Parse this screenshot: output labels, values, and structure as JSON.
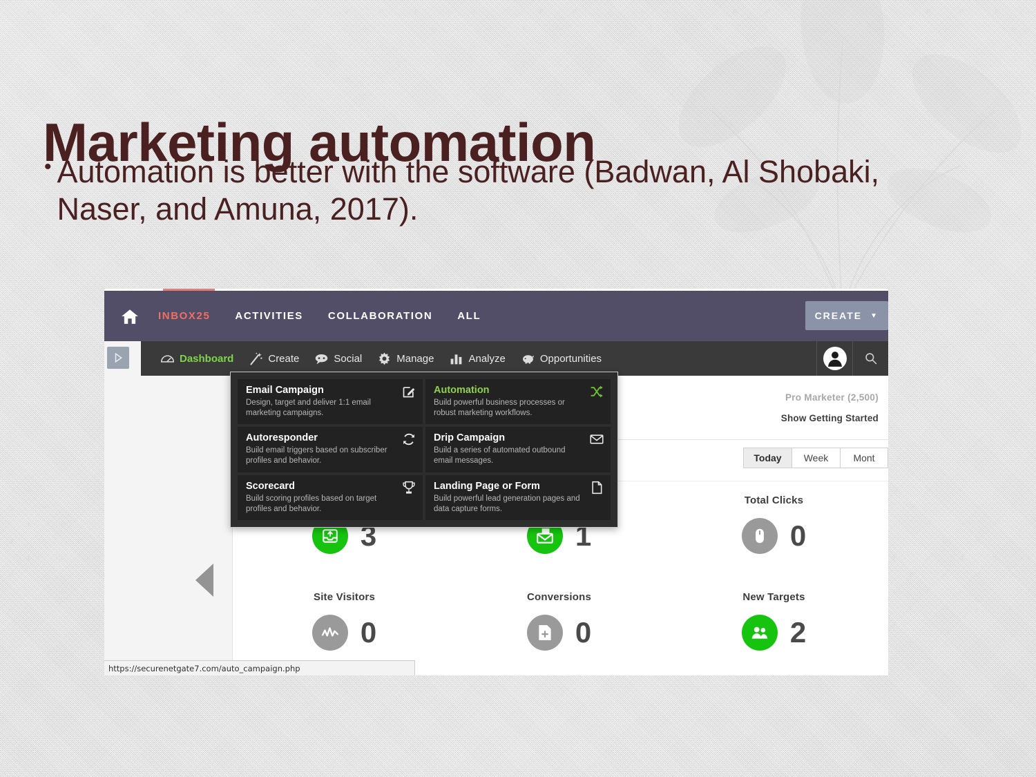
{
  "slide": {
    "title": "Marketing automation",
    "bullets": [
      "Automation is better with the software (Badwan, Al Shobaki, Naser, and Amuna, 2017)."
    ],
    "text_color": "#4a2020",
    "background_color": "#dcdcdc"
  },
  "app": {
    "top_nav": {
      "home_icon": "home-icon",
      "items": [
        {
          "label": "INBOX25",
          "accent": true
        },
        {
          "label": "ACTIVITIES",
          "accent": false
        },
        {
          "label": "COLLABORATION",
          "accent": false
        },
        {
          "label": "ALL",
          "accent": false
        }
      ],
      "create_button": {
        "label": "CREATE",
        "caret": "▼"
      },
      "bar_color": "#534e67",
      "accent_color": "#ef6f63",
      "create_button_color": "#8a93a8"
    },
    "toolbar": {
      "items": [
        {
          "label": "Dashboard",
          "icon": "gauge-icon",
          "active": true
        },
        {
          "label": "Create",
          "icon": "magic-wand-icon",
          "active": false
        },
        {
          "label": "Social",
          "icon": "speech-bubble-icon",
          "active": false
        },
        {
          "label": "Manage",
          "icon": "gear-icon",
          "active": false
        },
        {
          "label": "Analyze",
          "icon": "bar-chart-icon",
          "active": false
        },
        {
          "label": "Opportunities",
          "icon": "piggy-bank-icon",
          "active": false
        }
      ],
      "active_color": "#7fd44b",
      "bar_color": "#3a3a3a",
      "avatar_icon": "user-avatar-icon",
      "search_icon": "search-icon"
    },
    "expand_handle_icon": "play-triangle-icon",
    "back_arrow_icon": "left-triangle-icon",
    "create_dropdown": {
      "cards": [
        {
          "title": "Email Campaign",
          "desc": "Design, target and deliver 1:1 email marketing campaigns.",
          "icon": "compose-pencil-icon",
          "highlight": false
        },
        {
          "title": "Automation",
          "desc": "Build powerful business processes or robust marketing workflows.",
          "icon": "shuffle-icon",
          "highlight": true
        },
        {
          "title": "Autoresponder",
          "desc": "Build email triggers based on subscriber profiles and behavior.",
          "icon": "refresh-cycle-icon",
          "highlight": false
        },
        {
          "title": "Drip Campaign",
          "desc": "Build a series of automated outbound email messages.",
          "icon": "envelope-icon",
          "highlight": false
        },
        {
          "title": "Scorecard",
          "desc": "Build scoring profiles based on target profiles and behavior.",
          "icon": "trophy-icon",
          "highlight": false
        },
        {
          "title": "Landing Page or Form",
          "desc": "Build powerful lead generation pages and data capture forms.",
          "icon": "document-icon",
          "highlight": false
        }
      ],
      "highlight_color": "#8ed24b"
    },
    "dashboard": {
      "plan": "Pro Marketer (2,500)",
      "getting_started": "Show Getting Started",
      "range_tabs": [
        {
          "label": "Today",
          "active": true
        },
        {
          "label": "Week",
          "active": false
        },
        {
          "label": "Mont",
          "active": false
        }
      ],
      "stats": [
        {
          "label": "",
          "value": "3",
          "icon": "inbox-upload-icon",
          "color": "green"
        },
        {
          "label": "",
          "value": "1",
          "icon": "mail-sent-icon",
          "color": "green"
        },
        {
          "label": "Total Clicks",
          "value": "0",
          "icon": "mouse-icon",
          "color": "gray"
        },
        {
          "label": "Site Visitors",
          "value": "0",
          "icon": "pulse-line-icon",
          "color": "gray"
        },
        {
          "label": "Conversions",
          "value": "0",
          "icon": "document-plus-icon",
          "color": "gray"
        },
        {
          "label": "New Targets",
          "value": "2",
          "icon": "users-icon",
          "color": "green"
        }
      ],
      "green_color": "#16c40f",
      "gray_color": "#9a9a9a"
    },
    "status_bar": {
      "url": "https://securenetgate7.com/auto_campaign.php"
    }
  }
}
